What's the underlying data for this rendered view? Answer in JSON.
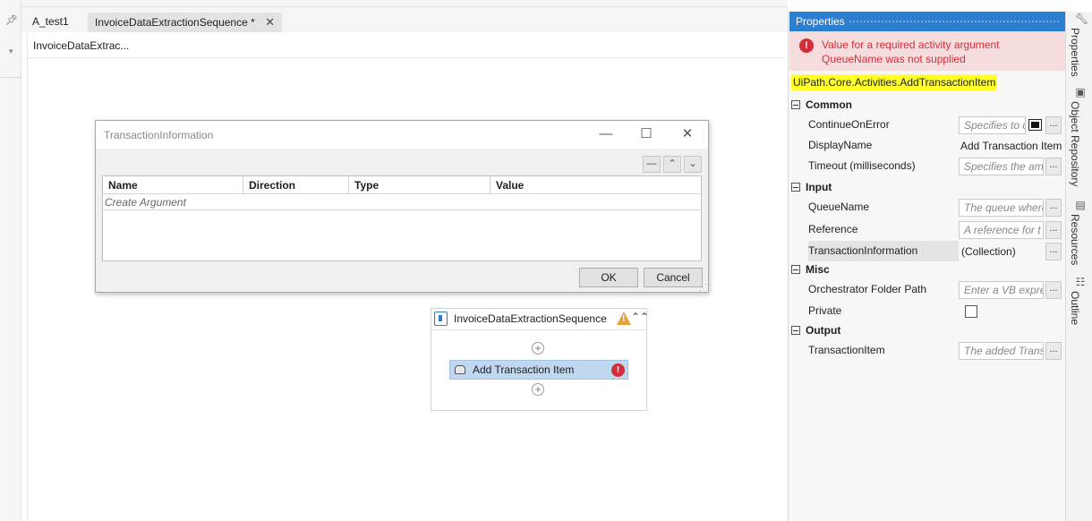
{
  "tabs": [
    {
      "label": "A_test1"
    },
    {
      "label": "InvoiceDataExtractionSequence *",
      "close": "✕"
    }
  ],
  "breadcrumb": "InvoiceDataExtrac...",
  "dialog": {
    "title": "TransactionInformation",
    "columns": [
      "Name",
      "Direction",
      "Type",
      "Value"
    ],
    "create_argument": "Create Argument",
    "ok_label": "OK",
    "cancel_label": "Cancel"
  },
  "sequence": {
    "title": "InvoiceDataExtractionSequence",
    "activity_label": "Add Transaction Item"
  },
  "properties": {
    "title": "Properties",
    "error": "Value for a required activity argument QueueName was not supplied",
    "type_name": "UiPath.Core.Activities.AddTransactionItem",
    "categories": {
      "common": "Common",
      "input": "Input",
      "misc": "Misc",
      "output": "Output"
    },
    "rows": {
      "continue_on_error": {
        "name": "ContinueOnError",
        "value": "Specifies to c"
      },
      "display_name": {
        "name": "DisplayName",
        "value": "Add Transaction Item"
      },
      "timeout": {
        "name": "Timeout (milliseconds)",
        "value": "Specifies the am"
      },
      "queue_name": {
        "name": "QueueName",
        "value": "The queue where"
      },
      "reference": {
        "name": "Reference",
        "value": "A reference for t"
      },
      "transaction_information": {
        "name": "TransactionInformation",
        "value": "(Collection)"
      },
      "folder_path": {
        "name": "Orchestrator Folder Path",
        "value": "Enter a VB expre"
      },
      "private": {
        "name": "Private",
        "checked": false
      },
      "transaction_item": {
        "name": "TransactionItem",
        "value": "The added Trans"
      }
    }
  },
  "right_sidebar": {
    "tabs": [
      "Properties",
      "Object Repository",
      "Resources",
      "Outline"
    ]
  },
  "colors": {
    "accent": "#2c7ed0",
    "error": "#d42d3a",
    "highlight": "#ffff2a",
    "selection": "#bfd8ef"
  }
}
